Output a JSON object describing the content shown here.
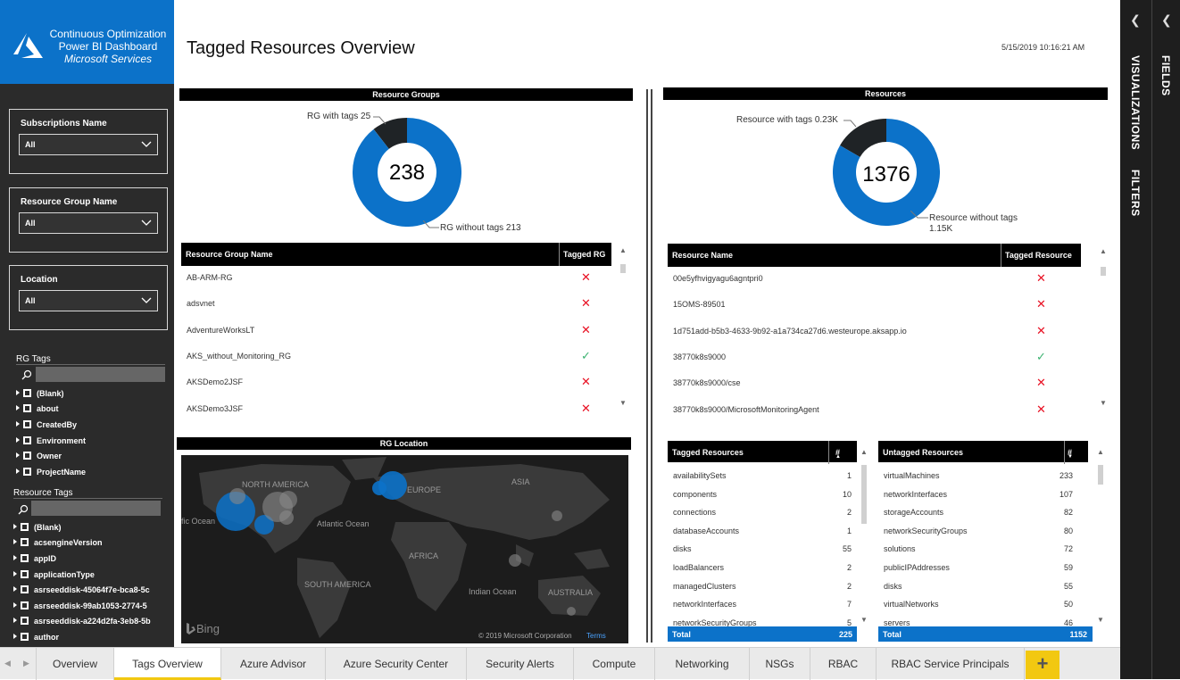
{
  "brand": {
    "line1": "Continuous Optimization",
    "line2": "Power BI Dashboard",
    "line3": "Microsoft Services"
  },
  "header": {
    "title": "Tagged Resources Overview",
    "timestamp": "5/15/2019 10:16:21 AM"
  },
  "slicers": [
    {
      "label": "Subscriptions Name",
      "value": "All"
    },
    {
      "label": "Resource Group Name",
      "value": "All"
    },
    {
      "label": "Location",
      "value": "All"
    }
  ],
  "rg_tags": {
    "title": "RG Tags",
    "items": [
      "(Blank)",
      "about",
      "CreatedBy",
      "Environment",
      "Owner",
      "ProjectName"
    ]
  },
  "resource_tags": {
    "title": "Resource Tags",
    "items": [
      "(Blank)",
      "acsengineVersion",
      "appID",
      "applicationType",
      "asrseeddisk-45064f7e-bca8-5c",
      "asrseeddisk-99ab1053-2774-5",
      "asrseeddisk-a224d2fa-3eb8-5b",
      "author"
    ]
  },
  "rg_donut": {
    "title": "Resource Groups",
    "center": "238",
    "label_tagged": "RG with tags 25",
    "label_untagged": "RG without tags 213",
    "tagged": 25,
    "untagged": 213
  },
  "res_donut": {
    "title": "Resources",
    "center": "1376",
    "label_tagged": "Resource with tags 0.23K",
    "label_untagged_1": "Resource without tags",
    "label_untagged_2": "1.15K",
    "tagged": 230,
    "untagged": 1150
  },
  "rg_table": {
    "col1": "Resource Group Name",
    "col2": "Tagged RG",
    "rows": [
      {
        "name": "AB-ARM-RG",
        "tagged": false
      },
      {
        "name": "adsvnet",
        "tagged": false
      },
      {
        "name": "AdventureWorksLT",
        "tagged": false
      },
      {
        "name": "AKS_without_Monitoring_RG",
        "tagged": true
      },
      {
        "name": "AKSDemo2JSF",
        "tagged": false
      },
      {
        "name": "AKSDemo3JSF",
        "tagged": false
      }
    ]
  },
  "res_table": {
    "col1": "Resource Name",
    "col2": "Tagged Resource",
    "rows": [
      {
        "name": "00e5yfhvigyagu6agntpri0",
        "tagged": false
      },
      {
        "name": "15OMS-89501",
        "tagged": false
      },
      {
        "name": "1d751add-b5b3-4633-9b92-a1a734ca27d6.westeurope.aksapp.io",
        "tagged": false
      },
      {
        "name": "38770k8s9000",
        "tagged": true
      },
      {
        "name": "38770k8s9000/cse",
        "tagged": false
      },
      {
        "name": "38770k8s9000/MicrosoftMonitoringAgent",
        "tagged": false
      }
    ]
  },
  "marks": {
    "cross": "✕",
    "check": "✓"
  },
  "map": {
    "title": "RG Location",
    "labels": {
      "north_america": "NORTH AMERICA",
      "europe": "EUROPE",
      "asia": "ASIA",
      "atlantic": "Atlantic Ocean",
      "pacific": "fic Ocean",
      "africa": "AFRICA",
      "south_america": "SOUTH AMERICA",
      "indian": "Indian Ocean",
      "australia": "AUSTRALIA"
    },
    "bing": "Bing",
    "copyright": "© 2019 Microsoft Corporation",
    "terms": "Terms"
  },
  "tagged_resources": {
    "col1": "Tagged Resources",
    "col2": "#",
    "rows": [
      {
        "name": "availabilitySets",
        "count": "1"
      },
      {
        "name": "components",
        "count": "10"
      },
      {
        "name": "connections",
        "count": "2"
      },
      {
        "name": "databaseAccounts",
        "count": "1"
      },
      {
        "name": "disks",
        "count": "55"
      },
      {
        "name": "loadBalancers",
        "count": "2"
      },
      {
        "name": "managedClusters",
        "count": "2"
      },
      {
        "name": "networkInterfaces",
        "count": "7"
      },
      {
        "name": "networkSecurityGroups",
        "count": "5"
      }
    ],
    "total_label": "Total",
    "total": "225"
  },
  "untagged_resources": {
    "col1": "Untagged Resources",
    "col2": "#",
    "rows": [
      {
        "name": "virtualMachines",
        "count": "233"
      },
      {
        "name": "networkInterfaces",
        "count": "107"
      },
      {
        "name": "storageAccounts",
        "count": "82"
      },
      {
        "name": "networkSecurityGroups",
        "count": "80"
      },
      {
        "name": "solutions",
        "count": "72"
      },
      {
        "name": "publicIPAddresses",
        "count": "59"
      },
      {
        "name": "disks",
        "count": "55"
      },
      {
        "name": "virtualNetworks",
        "count": "50"
      },
      {
        "name": "servers",
        "count": "46"
      }
    ],
    "total_label": "Total",
    "total": "1152"
  },
  "panes": {
    "fields": "FIELDS",
    "visualizations": "VISUALIZATIONS",
    "filters": "FILTERS"
  },
  "tabs": [
    "Overview",
    "Tags Overview",
    "Azure Advisor",
    "Azure Security Center",
    "Security Alerts",
    "Compute",
    "Networking",
    "NSGs",
    "RBAC",
    "RBAC Service Principals"
  ],
  "add_page": "+",
  "colors": {
    "accent": "#0c72c9",
    "dark": "#1f2326",
    "tab_active": "#f2c811"
  }
}
